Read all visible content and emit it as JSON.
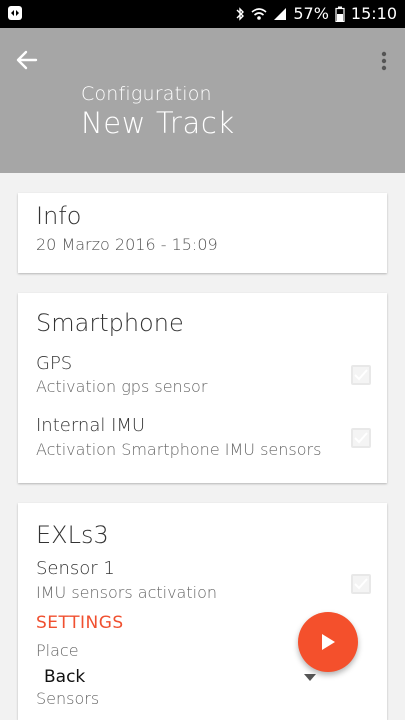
{
  "status_bar": {
    "battery": "57%",
    "time": "15:10",
    "icons": [
      "app-notification-icon",
      "bluetooth-icon",
      "wifi-icon",
      "signal-icon",
      "battery-icon"
    ]
  },
  "app_bar": {
    "subtitle": "Configuration",
    "title": "New Track",
    "icons": [
      "back-arrow-icon",
      "more-vert-icon"
    ]
  },
  "info_card": {
    "title": "Info",
    "date": "20 Marzo 2016 - 15:09"
  },
  "smartphone_card": {
    "title": "Smartphone",
    "items": [
      {
        "label": "GPS",
        "description": "Activation gps sensor"
      },
      {
        "label": "Internal IMU",
        "description": "Activation Smartphone IMU sensors"
      }
    ]
  },
  "exl_card": {
    "title": "EXLs3",
    "sensor": {
      "label": "Sensor 1",
      "description": "IMU sensors activation"
    },
    "settings_label": "SETTINGS",
    "place_label": "Place",
    "place_value": "Back",
    "sensors_label": "Sensors"
  },
  "fab": {
    "icon": "play-icon"
  },
  "colors": {
    "app_bar": "#a6a6a6",
    "accent": "#f4502c",
    "settings": "#f05030"
  }
}
